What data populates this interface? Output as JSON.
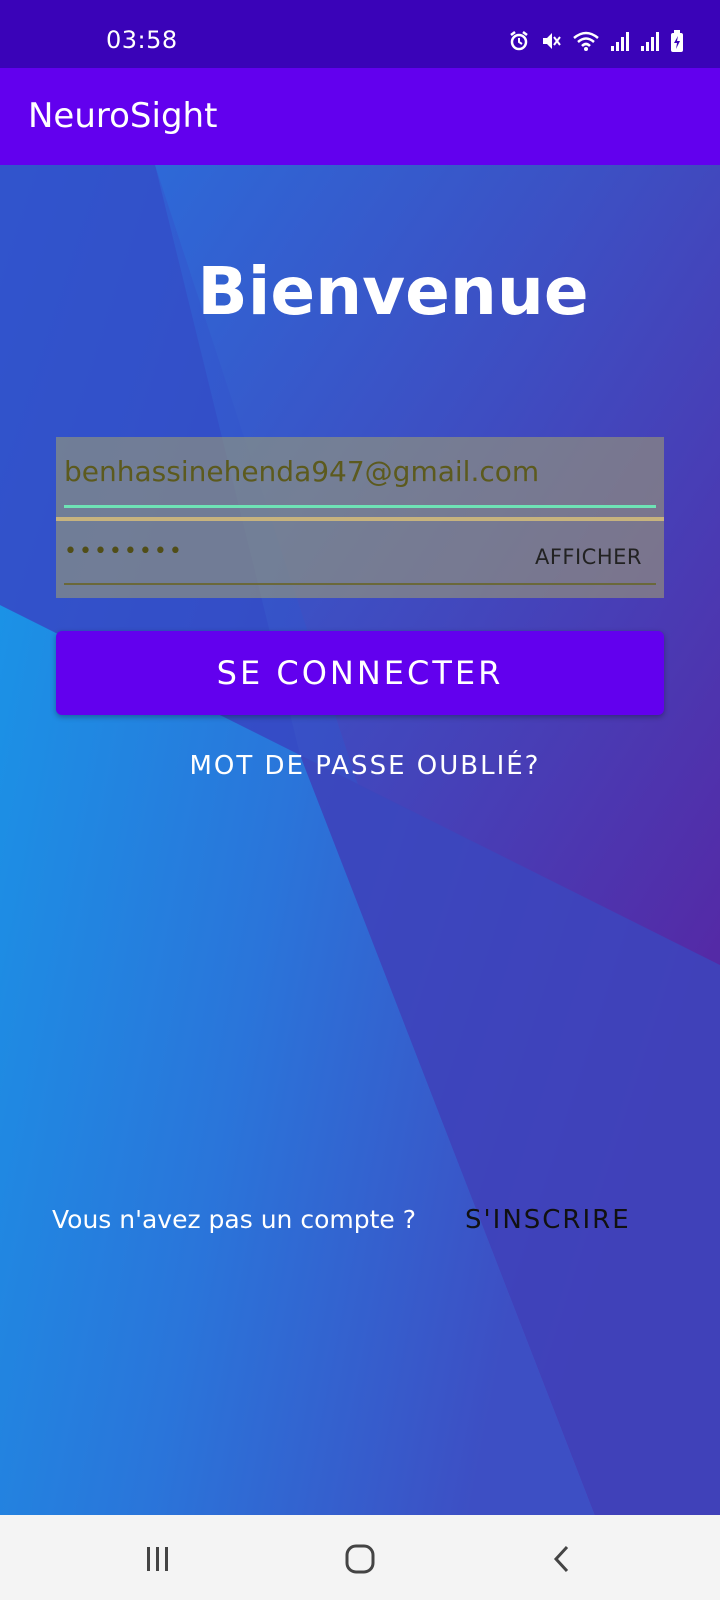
{
  "status": {
    "time": "03:58",
    "icons": [
      "alarm-icon",
      "mute-icon",
      "wifi-icon",
      "signal-icon",
      "signal-icon",
      "battery-icon"
    ]
  },
  "app": {
    "title": "NeuroSight"
  },
  "login": {
    "heading": "Bienvenue",
    "email_value": "benhassinehenda947@gmail.com",
    "password_mask": "••••••••",
    "show_label": "AFFICHER",
    "submit_label": "SE CONNECTER",
    "forgot_label": "MOT DE PASSE OUBLIÉ?",
    "no_account_text": "Vous n'avez pas un compte ?",
    "signup_label": "S'INSCRIRE"
  },
  "nav": [
    "recent-apps-icon",
    "home-icon",
    "back-icon"
  ],
  "colors": {
    "status_bar": "#3a03b8",
    "app_bar": "#6200ee",
    "button": "#6200ee",
    "background_blue": "#1f80e0",
    "background_purple": "#4a2fa8"
  }
}
